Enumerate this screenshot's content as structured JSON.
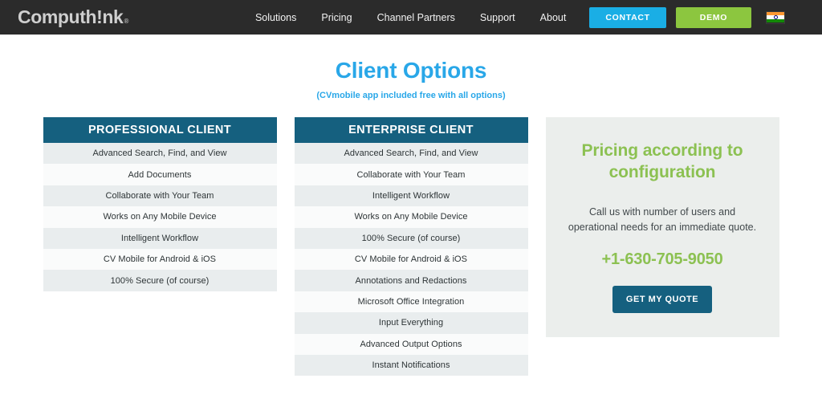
{
  "navbar": {
    "logo_main": "Computh",
    "logo_tail": "nk",
    "logo_trademark": "®",
    "links": [
      {
        "label": "Solutions"
      },
      {
        "label": "Pricing"
      },
      {
        "label": "Channel Partners"
      },
      {
        "label": "Support"
      },
      {
        "label": "About"
      }
    ],
    "contact_label": "CONTACT",
    "demo_label": "DEMO",
    "flag_icon": "india-flag-icon",
    "colors": {
      "bar": "#2b2b2b",
      "contact": "#1aaee5",
      "demo": "#8cc63f"
    }
  },
  "hero": {
    "title": "Client Options",
    "subtitle": "(CVmobile app included free with all options)",
    "title_color": "#29a7e8"
  },
  "columns": [
    {
      "heading": "PROFESSIONAL CLIENT",
      "features": [
        "Advanced Search, Find, and View",
        "Add Documents",
        "Collaborate with Your Team",
        "Works on Any Mobile Device",
        "Intelligent Workflow",
        "CV Mobile for Android & iOS",
        "100% Secure (of course)"
      ]
    },
    {
      "heading": "ENTERPRISE CLIENT",
      "features": [
        "Advanced Search, Find, and View",
        "Collaborate with Your Team",
        "Intelligent Workflow",
        "Works on Any Mobile Device",
        "100% Secure (of course)",
        "CV Mobile for Android & iOS",
        "Annotations and Redactions",
        "Microsoft Office Integration",
        "Input Everything",
        "Advanced Output Options",
        "Instant Notifications"
      ]
    }
  ],
  "pricing": {
    "title": "Pricing according to configuration",
    "description": "Call us with number of users and operational needs for an immediate quote.",
    "phone": "+1-630-705-9050",
    "quote_label": "GET MY QUOTE",
    "accent_color": "#8cc152",
    "panel_color": "#ebeeec",
    "button_color": "#15607f"
  },
  "theme": {
    "card_header_color": "#15607f",
    "row_odd": "#e9edee",
    "row_even": "#fafbfb"
  }
}
